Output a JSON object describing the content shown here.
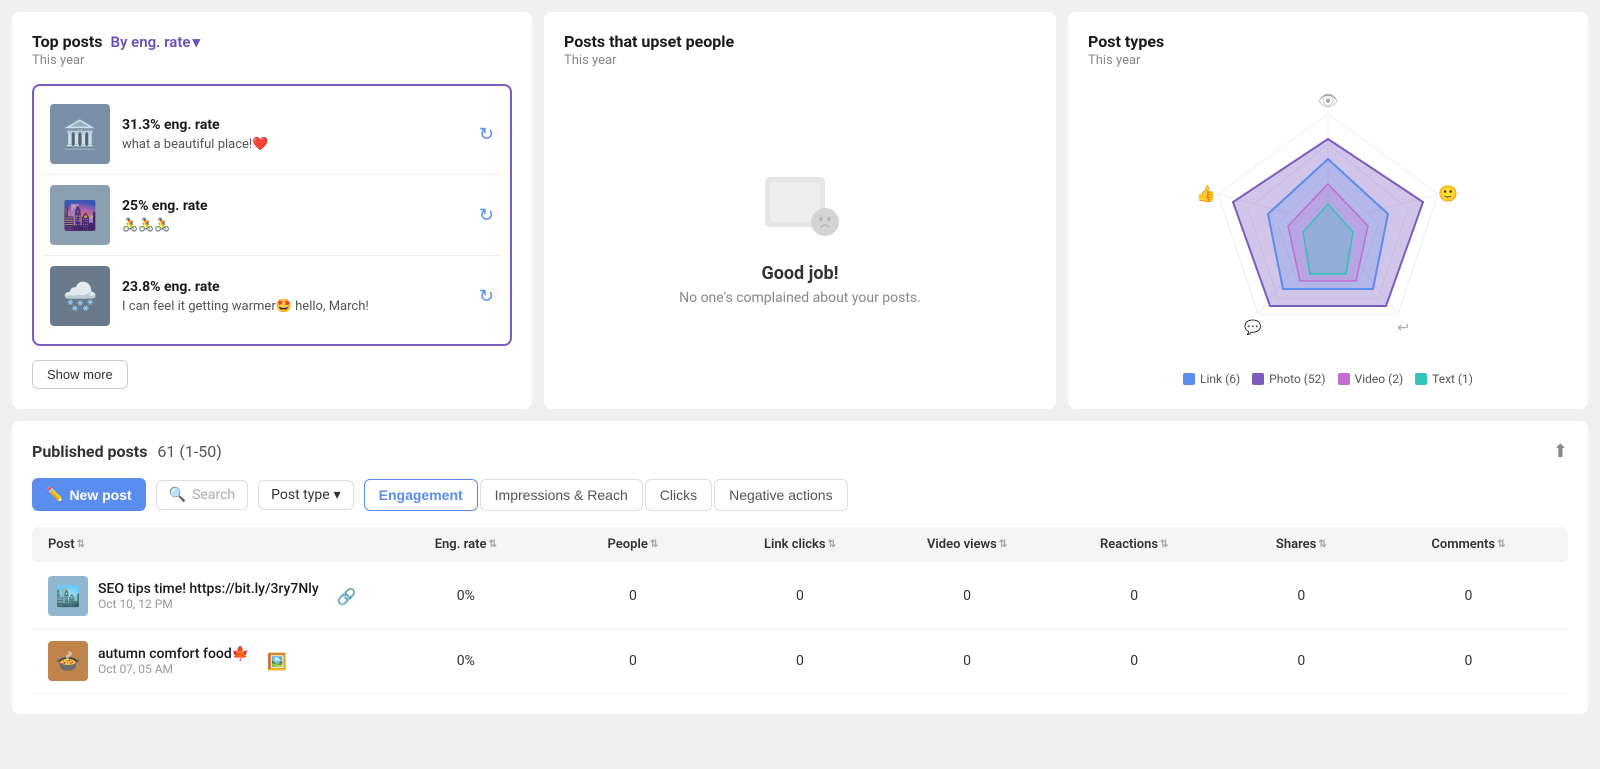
{
  "top_posts": {
    "title": "Top posts",
    "filter_label": "By eng. rate",
    "subtitle": "This year",
    "posts": [
      {
        "eng_rate": "31.3% eng. rate",
        "caption": "what a beautiful place!❤️",
        "thumb_color": "#7a8fa6",
        "thumb_icon": "🏛️"
      },
      {
        "eng_rate": "25% eng. rate",
        "caption": "🚴🚴🚴",
        "thumb_color": "#8a9fb0",
        "thumb_icon": "🌆"
      },
      {
        "eng_rate": "23.8% eng. rate",
        "caption": "I can feel it getting warmer🤩 hello, March!",
        "thumb_color": "#6a7a8a",
        "thumb_icon": "🌨️"
      }
    ],
    "show_more_label": "Show more"
  },
  "upset": {
    "title": "Posts that upset people",
    "subtitle": "This year",
    "good_label": "Good job!",
    "good_desc": "No one's complained about your posts."
  },
  "post_types": {
    "title": "Post types",
    "subtitle": "This year",
    "legend": [
      {
        "label": "Link (6)",
        "color": "#5b8def"
      },
      {
        "label": "Photo (52)",
        "color": "#7c5cbf"
      },
      {
        "label": "Video (2)",
        "color": "#c26ed0"
      },
      {
        "label": "Text (1)",
        "color": "#2ec4b6"
      }
    ]
  },
  "published_posts": {
    "title": "Published posts",
    "count": "61 (1-50)",
    "new_post_label": "New post",
    "search_placeholder": "Search",
    "post_type_label": "Post type",
    "tabs": [
      {
        "label": "Engagement",
        "active": true
      },
      {
        "label": "Impressions & Reach",
        "active": false
      },
      {
        "label": "Clicks",
        "active": false
      },
      {
        "label": "Negative actions",
        "active": false
      }
    ],
    "columns": [
      "Post",
      "Eng. rate",
      "People",
      "Link clicks",
      "Video views",
      "Reactions",
      "Shares",
      "Comments"
    ],
    "rows": [
      {
        "title": "SEO tips time! https://bit.ly/3ry7Nly",
        "date": "Oct 10, 12 PM",
        "type_icon": "🔗",
        "thumb_color": "#8fa8c0",
        "thumb_bg": "#a0bfd0",
        "eng_rate": "0%",
        "people": "0",
        "link_clicks": "0",
        "video_views": "0",
        "reactions": "0",
        "shares": "0",
        "comments": "0"
      },
      {
        "title": "autumn comfort food🍁",
        "date": "Oct 07, 05 AM",
        "type_icon": "🖼️",
        "thumb_color": "#c0844a",
        "thumb_bg": "#d4995a",
        "eng_rate": "0%",
        "people": "0",
        "link_clicks": "0",
        "video_views": "0",
        "reactions": "0",
        "shares": "0",
        "comments": "0"
      }
    ]
  }
}
